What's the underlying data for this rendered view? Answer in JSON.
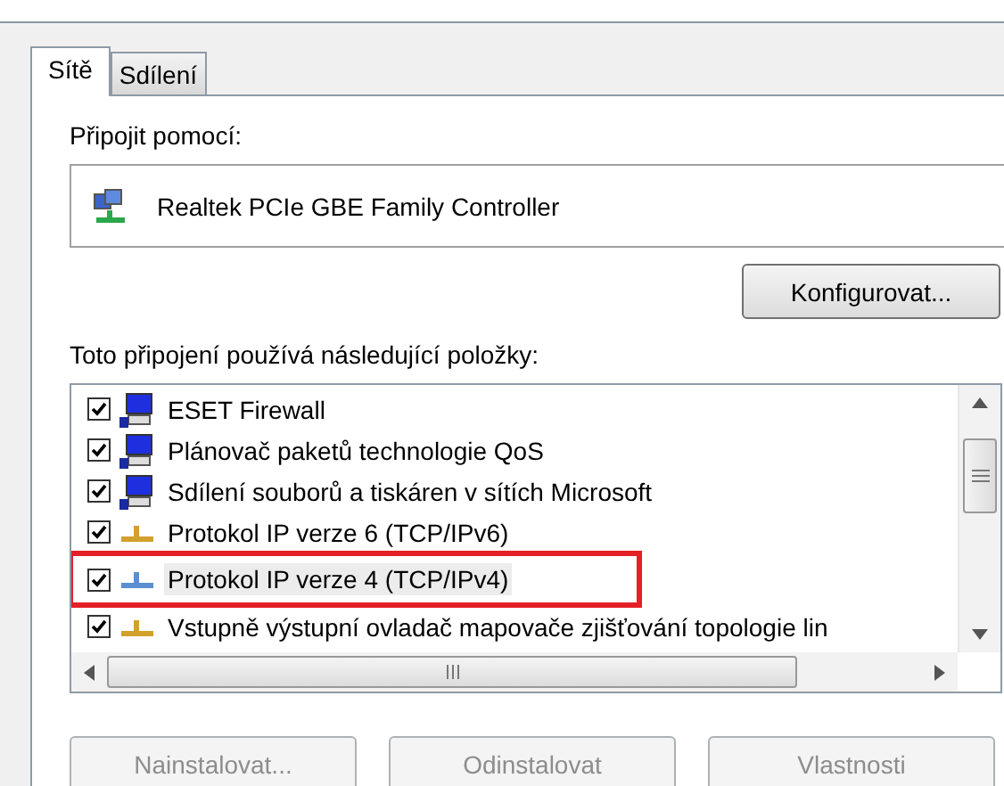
{
  "tabs": [
    {
      "label": "Sítě",
      "selected": true
    },
    {
      "label": "Sdílení",
      "selected": false
    }
  ],
  "connect_label": "Připojit pomocí:",
  "adapter": "Realtek PCIe GBE Family Controller",
  "configure_button": "Konfigurovat...",
  "items_label": "Toto připojení používá následující položky:",
  "items": [
    {
      "kind": "service",
      "label": "ESET Firewall",
      "checked": true,
      "selected": false,
      "highlighted": false,
      "color": "#1e2fe0"
    },
    {
      "kind": "service",
      "label": "Plánovač paketů technologie QoS",
      "checked": true,
      "selected": false,
      "highlighted": false,
      "color": "#1e2fe0"
    },
    {
      "kind": "service",
      "label": "Sdílení souborů a tiskáren v sítích Microsoft",
      "checked": true,
      "selected": false,
      "highlighted": false,
      "color": "#1e2fe0"
    },
    {
      "kind": "protocol",
      "label": "Protokol IP verze 6 (TCP/IPv6)",
      "checked": true,
      "selected": false,
      "highlighted": false,
      "color": "#d2a02c"
    },
    {
      "kind": "protocol",
      "label": "Protokol IP verze 4 (TCP/IPv4)",
      "checked": true,
      "selected": true,
      "highlighted": true,
      "color": "#5a8fd0"
    },
    {
      "kind": "protocol",
      "label": "Vstupně výstupní ovladač mapovače zjišťování topologie lin",
      "checked": true,
      "selected": false,
      "highlighted": false,
      "color": "#d2a02c"
    }
  ],
  "buttons": [
    {
      "label": "Nainstalovat...",
      "disabled": true
    },
    {
      "label": "Odinstalovat",
      "disabled": true
    },
    {
      "label": "Vlastnosti",
      "disabled": true
    }
  ]
}
